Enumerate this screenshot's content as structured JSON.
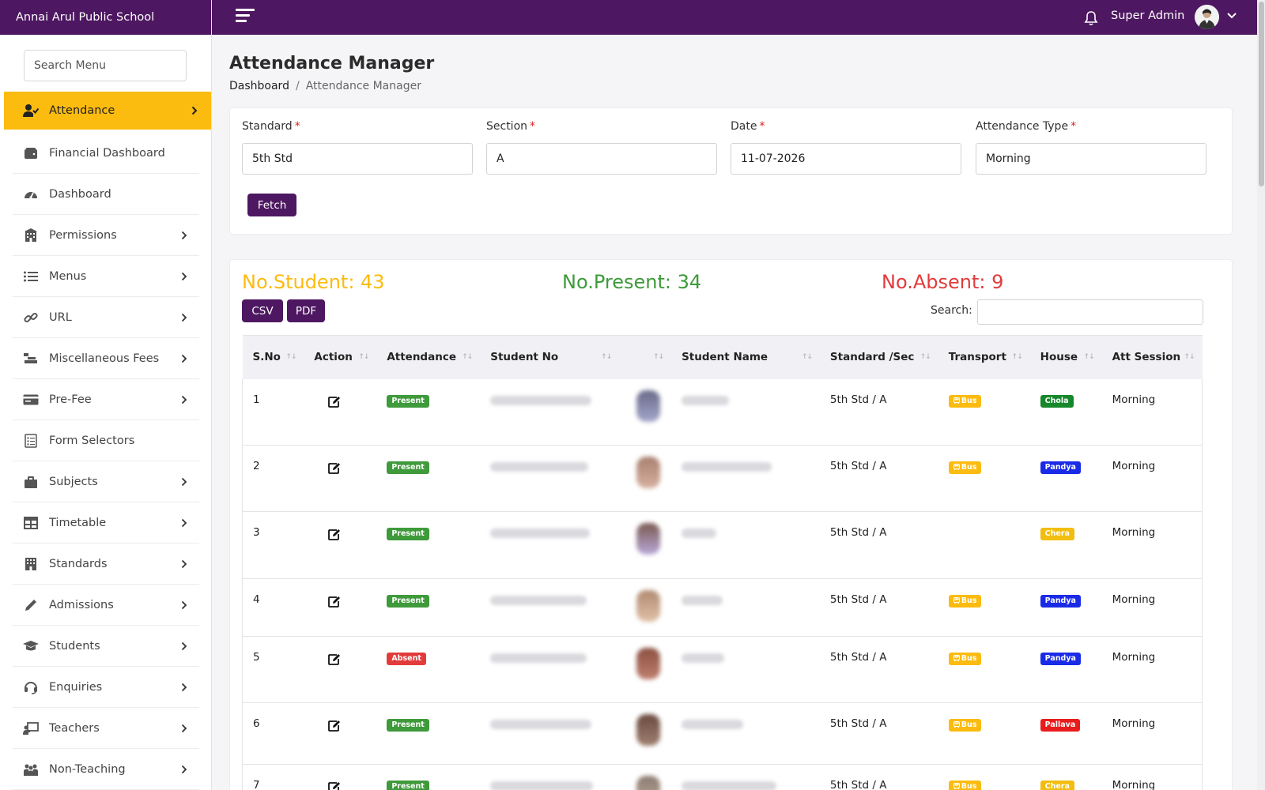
{
  "app": {
    "brand": "Annai Arul Public School",
    "user_name": "Super Admin"
  },
  "sidebar": {
    "search_placeholder": "Search Menu",
    "items": [
      {
        "label": "Attendance",
        "icon": "user-check-icon",
        "active": true,
        "has_children": true
      },
      {
        "label": "Financial Dashboard",
        "icon": "wallet-icon",
        "active": false,
        "has_children": false
      },
      {
        "label": "Dashboard",
        "icon": "gauge-icon",
        "active": false,
        "has_children": false
      },
      {
        "label": "Permissions",
        "icon": "building-icon",
        "active": false,
        "has_children": true
      },
      {
        "label": "Menus",
        "icon": "list-icon",
        "active": false,
        "has_children": true
      },
      {
        "label": "URL",
        "icon": "link-icon",
        "active": false,
        "has_children": true
      },
      {
        "label": "Miscellaneous Fees",
        "icon": "cash-register-icon",
        "active": false,
        "has_children": true
      },
      {
        "label": "Pre-Fee",
        "icon": "card-icon",
        "active": false,
        "has_children": true
      },
      {
        "label": "Form Selectors",
        "icon": "form-icon",
        "active": false,
        "has_children": false
      },
      {
        "label": "Subjects",
        "icon": "books-icon",
        "active": false,
        "has_children": true
      },
      {
        "label": "Timetable",
        "icon": "table-icon",
        "active": false,
        "has_children": true
      },
      {
        "label": "Standards",
        "icon": "school-building-icon",
        "active": false,
        "has_children": true
      },
      {
        "label": "Admissions",
        "icon": "pencil-icon",
        "active": false,
        "has_children": true
      },
      {
        "label": "Students",
        "icon": "graduation-cap-icon",
        "active": false,
        "has_children": true
      },
      {
        "label": "Enquiries",
        "icon": "headset-icon",
        "active": false,
        "has_children": true
      },
      {
        "label": "Teachers",
        "icon": "chalkboard-teacher-icon",
        "active": false,
        "has_children": true
      },
      {
        "label": "Non-Teaching",
        "icon": "people-icon",
        "active": false,
        "has_children": true
      }
    ]
  },
  "page": {
    "title": "Attendance Manager",
    "breadcrumb": {
      "home": "Dashboard",
      "current": "Attendance Manager"
    }
  },
  "filters": {
    "standard": {
      "label": "Standard",
      "value": "5th Std"
    },
    "section": {
      "label": "Section",
      "value": "A"
    },
    "date": {
      "label": "Date",
      "value": "11-07-2026"
    },
    "attendance_type": {
      "label": "Attendance Type",
      "value": "Morning"
    },
    "fetch_label": "Fetch"
  },
  "stats": {
    "total": "No.Student: 43",
    "present": "No.Present: 34",
    "absent": "No.Absent: 9"
  },
  "table": {
    "csv_label": "CSV",
    "pdf_label": "PDF",
    "search_label": "Search:",
    "columns": [
      "S.No",
      "Action",
      "Attendance",
      "Student No",
      "",
      "Student Name",
      "Standard /Sec",
      "Transport",
      "House",
      "Att Session"
    ],
    "rows": [
      {
        "sno": "1",
        "attendance": "Present",
        "status": "present",
        "std_sec": "5th Std / A",
        "transport": "Bus",
        "house": "Chola",
        "house_key": "chola",
        "session": "Morning"
      },
      {
        "sno": "2",
        "attendance": "Present",
        "status": "present",
        "std_sec": "5th Std / A",
        "transport": "Bus",
        "house": "Pandya",
        "house_key": "pandya",
        "session": "Morning"
      },
      {
        "sno": "3",
        "attendance": "Present",
        "status": "present",
        "std_sec": "5th Std / A",
        "transport": "",
        "house": "Chera",
        "house_key": "chera",
        "session": "Morning"
      },
      {
        "sno": "4",
        "attendance": "Present",
        "status": "present",
        "std_sec": "5th Std / A",
        "transport": "Bus",
        "house": "Pandya",
        "house_key": "pandya",
        "session": "Morning"
      },
      {
        "sno": "5",
        "attendance": "Absent",
        "status": "absent",
        "std_sec": "5th Std / A",
        "transport": "Bus",
        "house": "Pandya",
        "house_key": "pandya",
        "session": "Morning"
      },
      {
        "sno": "6",
        "attendance": "Present",
        "status": "present",
        "std_sec": "5th Std / A",
        "transport": "Bus",
        "house": "Pallava",
        "house_key": "pallava",
        "session": "Morning"
      },
      {
        "sno": "7",
        "attendance": "Present",
        "status": "present",
        "std_sec": "5th Std / A",
        "transport": "Bus",
        "house": "Chera",
        "house_key": "chera",
        "session": "Morning"
      }
    ]
  },
  "colors": {
    "brand_purple": "#4e1761",
    "accent_yellow": "#fbbb0f",
    "present_green": "#3e9a3a",
    "absent_red": "#e23b3b"
  }
}
